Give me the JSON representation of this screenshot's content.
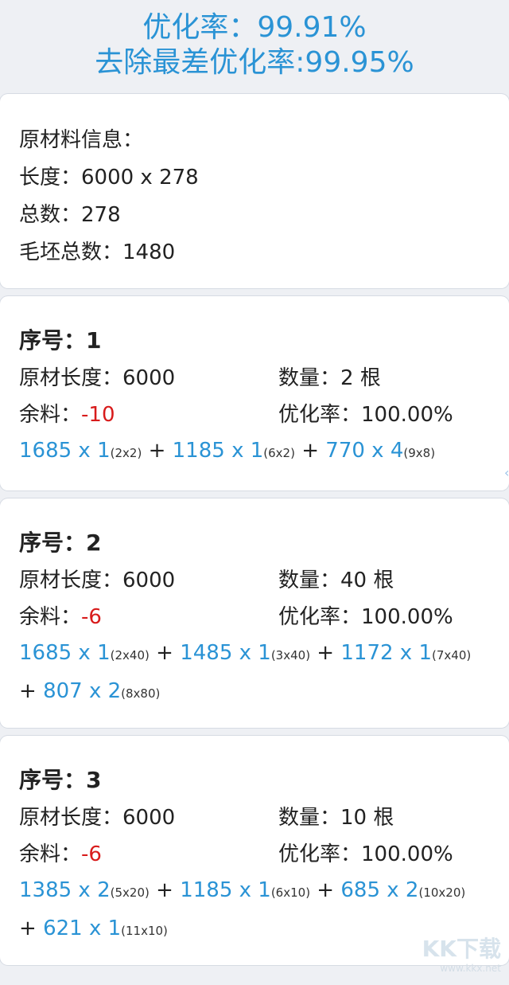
{
  "header": {
    "rate_line": "优化率：99.91%",
    "rate_excl_line": "去除最差优化率:99.95%"
  },
  "material": {
    "title": "原材料信息：",
    "length": "长度：6000 x 278",
    "total": "总数：278",
    "blank_total": "毛坯总数：1480"
  },
  "groups": [
    {
      "seq": "序号：1",
      "length_label": "原材长度：",
      "length_value": "6000",
      "qty_label": "数量：",
      "qty_value": "2 根",
      "remain_label": "余料：",
      "remain_value": "-10",
      "rate_label": "优化率：",
      "rate_value": "100.00%",
      "pieces": [
        {
          "main": "1685 x 1",
          "sub": "(2x2)"
        },
        {
          "main": "1185 x 1",
          "sub": "(6x2)"
        },
        {
          "main": "770 x 4",
          "sub": "(9x8)"
        }
      ]
    },
    {
      "seq": "序号：2",
      "length_label": "原材长度：",
      "length_value": "6000",
      "qty_label": "数量：",
      "qty_value": "40 根",
      "remain_label": "余料：",
      "remain_value": "-6",
      "rate_label": "优化率：",
      "rate_value": "100.00%",
      "pieces": [
        {
          "main": "1685 x 1",
          "sub": "(2x40)"
        },
        {
          "main": "1485 x 1",
          "sub": "(3x40)"
        },
        {
          "main": "1172 x 1",
          "sub": "(7x40)"
        },
        {
          "main": "807 x 2",
          "sub": "(8x80)"
        }
      ]
    },
    {
      "seq": "序号：3",
      "length_label": "原材长度：",
      "length_value": "6000",
      "qty_label": "数量：",
      "qty_value": "10 根",
      "remain_label": "余料：",
      "remain_value": "-6",
      "rate_label": "优化率：",
      "rate_value": "100.00%",
      "pieces": [
        {
          "main": "1385 x 2",
          "sub": "(5x20)"
        },
        {
          "main": "1185 x 1",
          "sub": "(6x10)"
        },
        {
          "main": "685 x 2",
          "sub": "(10x20)"
        },
        {
          "main": "621 x 1",
          "sub": "(11x10)"
        }
      ]
    }
  ],
  "plus_sign": " + ",
  "watermark": {
    "brand": "KK下载",
    "url": "www.kkx.net"
  },
  "colors": {
    "accent": "#2a93d5",
    "negative": "#d81b1b",
    "background": "#eef0f4"
  }
}
